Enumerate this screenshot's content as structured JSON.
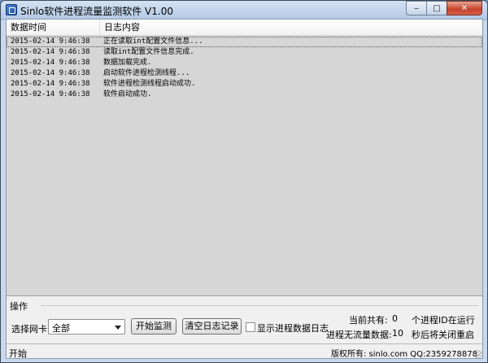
{
  "window": {
    "title": "Sinlo软件进程流量监测软件 V1.00",
    "controls": {
      "minimize": "‒",
      "maximize": "□",
      "close": "✕"
    }
  },
  "log": {
    "columns": {
      "time": "数据时间",
      "message": "日志内容"
    },
    "rows": [
      {
        "time": "2015-02-14 9:46:38",
        "message": "正在读取int配置文件信息..."
      },
      {
        "time": "2015-02-14 9:46:38",
        "message": "读取int配置文件信息完成."
      },
      {
        "time": "2015-02-14 9:46:38",
        "message": "数据加载完成."
      },
      {
        "time": "2015-02-14 9:46:38",
        "message": "启动软件进程检测线程..."
      },
      {
        "time": "2015-02-14 9:46:38",
        "message": "软件进程检测线程启动成功."
      },
      {
        "time": "2015-02-14 9:46:38",
        "message": "软件启动成功."
      }
    ]
  },
  "operations": {
    "group_label": "操作",
    "nic_label": "选择网卡",
    "nic_selected": "全部",
    "start_button": "开始监测",
    "clear_button": "清空日志记录",
    "show_log_label": "显示进程数据日志",
    "current_total_label": "当前共有:",
    "current_total_value": "0",
    "running_label": "个进程ID在运行",
    "no_traffic_label": "进程无流量数据:",
    "no_traffic_value": "10",
    "restart_label": "秒后将关闭重启"
  },
  "status": {
    "left": "开始",
    "right": "版权所有: sinlo.com QQ:2359278878"
  }
}
